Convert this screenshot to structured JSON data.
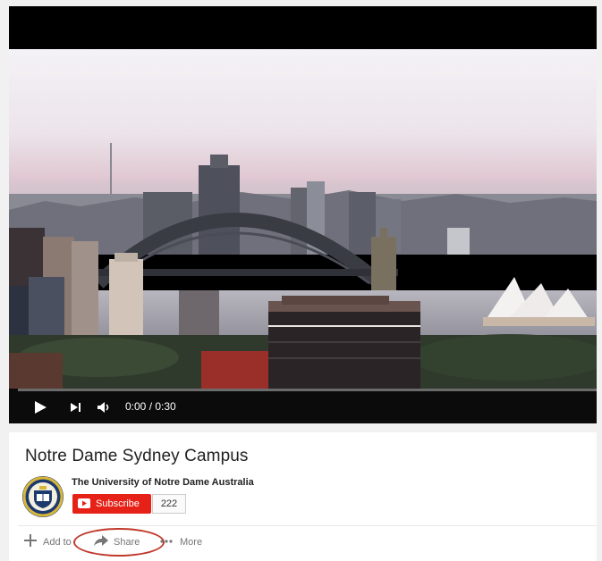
{
  "video": {
    "current_time": "0:00",
    "duration": "0:30",
    "time_display": "0:00 / 0:30",
    "progress": 0
  },
  "title": "Notre Dame Sydney Campus",
  "channel": {
    "name": "The University of Notre Dame Australia",
    "subscribe_label": "Subscribe",
    "subscriber_count": "222"
  },
  "actions": {
    "add_to": "Add to",
    "share": "Share",
    "more": "More"
  },
  "colors": {
    "subscribe_red": "#e62117",
    "annotation_circle": "#c0392b",
    "player_bg": "#000000"
  },
  "icons": [
    "play-icon",
    "next-icon",
    "volume-icon",
    "youtube-logo-icon",
    "plus-icon",
    "share-arrow-icon",
    "more-dots-icon"
  ]
}
